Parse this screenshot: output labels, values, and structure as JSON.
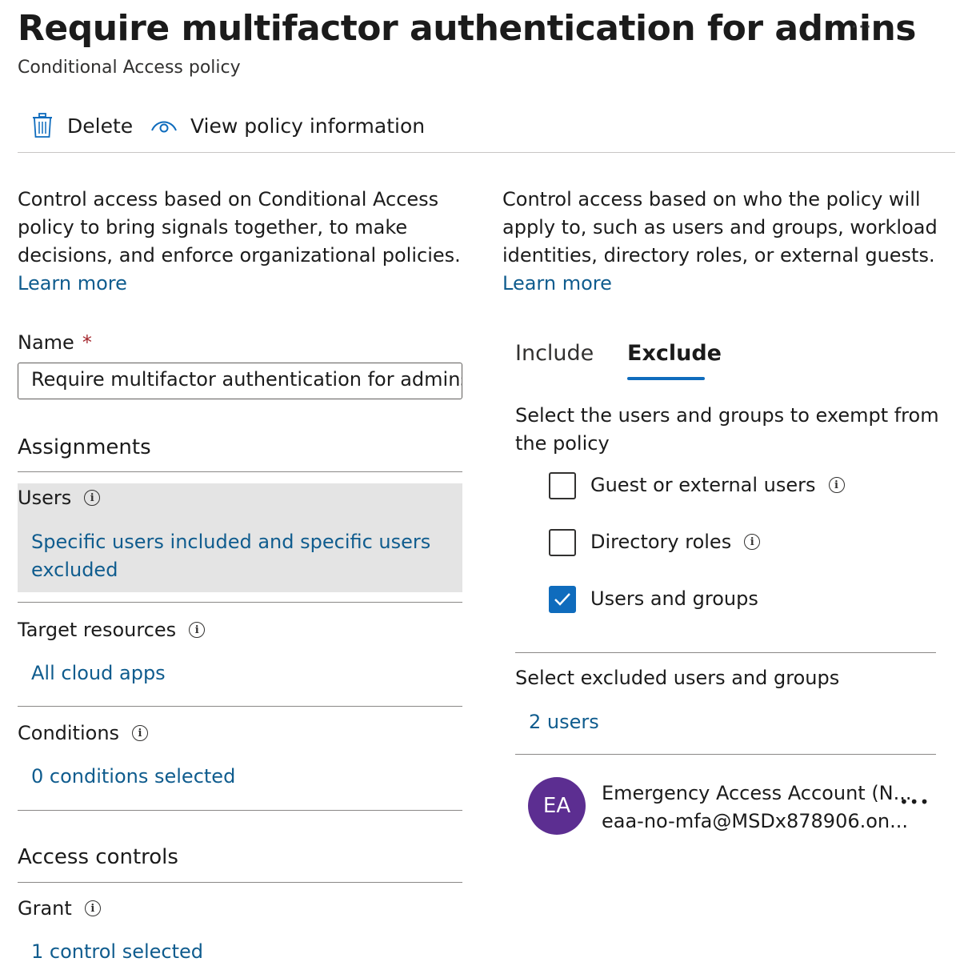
{
  "header": {
    "title": "Require multifactor authentication for admins",
    "more_label": "···",
    "subtitle": "Conditional Access policy"
  },
  "toolbar": {
    "delete_label": "Delete",
    "view_label": "View policy information"
  },
  "left_intro": {
    "text_lines": [
      "Control access based on Conditional Access",
      "policy to bring signals together, to make",
      "decisions, and enforce organizational policies."
    ],
    "learn_more": "Learn more"
  },
  "right_intro": {
    "text_lines": [
      "Control access based on who the policy will",
      "apply to, such as users and groups, workload",
      "identities, directory roles, or external guests."
    ],
    "learn_more": "Learn more"
  },
  "name_field": {
    "label": "Name",
    "required_mark": "*",
    "value": "Require multifactor authentication for admins"
  },
  "assignments": {
    "heading": "Assignments",
    "users": {
      "label": "Users",
      "value_lines": [
        "Specific users included and specific users",
        "excluded"
      ]
    },
    "target_resources": {
      "label": "Target resources",
      "value": "All cloud apps"
    },
    "conditions": {
      "label": "Conditions",
      "value": "0 conditions selected"
    }
  },
  "access_controls": {
    "heading": "Access controls",
    "grant": {
      "label": "Grant",
      "value": "1 control selected"
    }
  },
  "tabs": {
    "include": "Include",
    "exclude": "Exclude",
    "active": "Exclude"
  },
  "exclude_panel": {
    "instruction_lines": [
      "Select the users and groups to exempt from",
      "the policy"
    ],
    "options": [
      {
        "label": "Guest or external users",
        "checked": false,
        "info": true
      },
      {
        "label": "Directory roles",
        "checked": false,
        "info": true
      },
      {
        "label": "Users and groups",
        "checked": true,
        "info": false
      }
    ],
    "select_label": "Select excluded users and groups",
    "selected_count": "2 users",
    "user": {
      "initials": "EA",
      "name": "Emergency Access Account (N...",
      "email": "eaa-no-mfa@MSDx878906.on...",
      "more_label": "•••"
    }
  },
  "colors": {
    "link": "#0f5c8e",
    "accent": "#0f6cbd",
    "avatar": "#5c2e91",
    "selected_row": "#e4e4e4"
  },
  "icons": {
    "delete": "trash-icon",
    "view": "eye-icon",
    "info": "info-icon",
    "check": "checkmark-icon"
  }
}
